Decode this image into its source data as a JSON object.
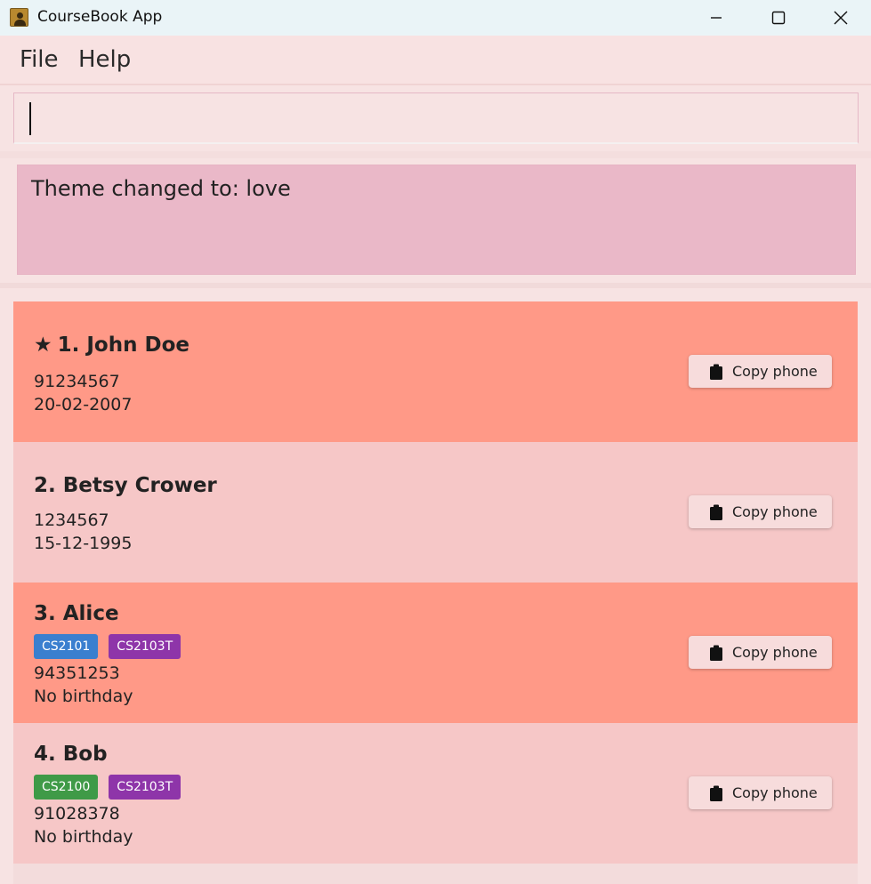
{
  "window": {
    "title": "CourseBook App",
    "minimize_icon": "minimize-icon",
    "maximize_icon": "maximize-icon",
    "close_icon": "close-icon"
  },
  "menu": {
    "file": "File",
    "help": "Help"
  },
  "command": {
    "value": "",
    "placeholder": ""
  },
  "result": {
    "text": "Theme changed to: love"
  },
  "persons": [
    {
      "favorite": true,
      "star": "★",
      "name": "1. John Doe",
      "phone": "91234567",
      "birthday": "20-02-2007",
      "tags": [],
      "copy_label": "Copy phone"
    },
    {
      "favorite": false,
      "name": "2. Betsy Crower",
      "phone": "1234567",
      "birthday": "15-12-1995",
      "tags": [],
      "copy_label": "Copy phone"
    },
    {
      "favorite": false,
      "name": "3. Alice",
      "phone": "94351253",
      "birthday": "No birthday",
      "tags": [
        {
          "label": "CS2101",
          "color": "#3a7fcf"
        },
        {
          "label": "CS2103T",
          "color": "#8e35a9"
        }
      ],
      "copy_label": "Copy phone"
    },
    {
      "favorite": false,
      "name": "4. Bob",
      "phone": "91028378",
      "birthday": "No birthday",
      "tags": [
        {
          "label": "CS2100",
          "color": "#3f9a47"
        },
        {
          "label": "CS2103T",
          "color": "#8e35a9"
        }
      ],
      "copy_label": "Copy phone"
    }
  ],
  "colors": {
    "card_odd": "#ff9987",
    "card_even": "#f6c7c7",
    "result_bg": "#eab8c8",
    "background": "#f7e3e3"
  }
}
